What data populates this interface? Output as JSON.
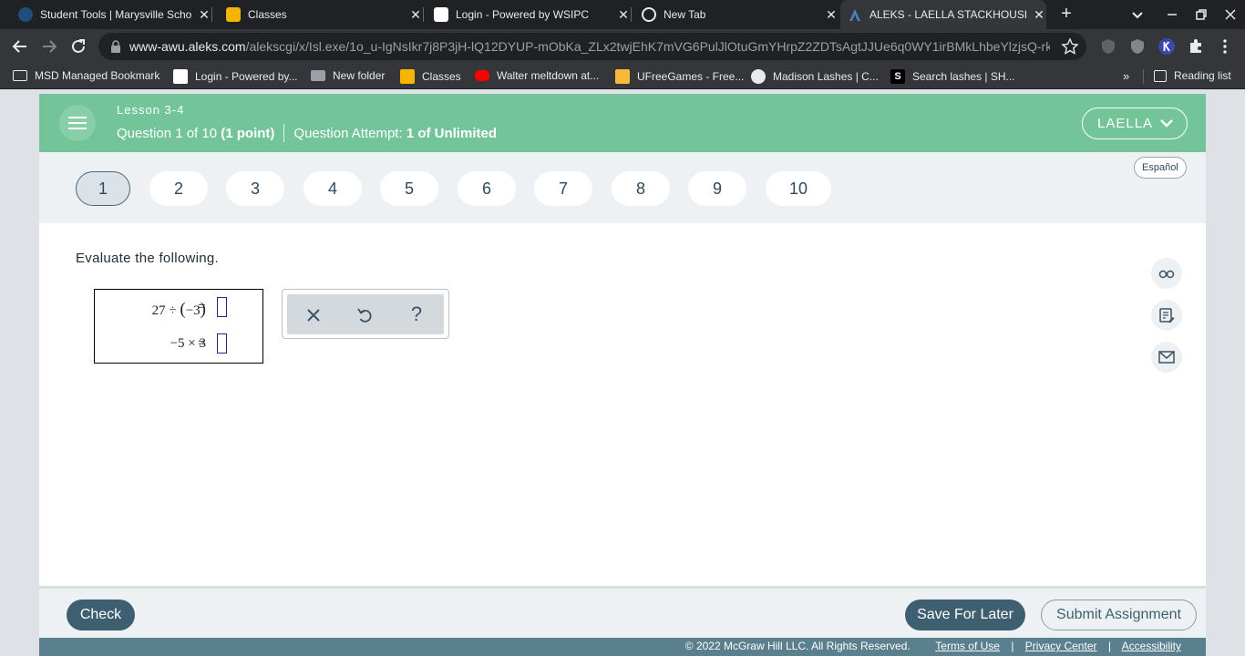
{
  "browser": {
    "tabs": [
      {
        "title": "Student Tools | Marysville Scho",
        "icon": "marysville-icon",
        "active": false
      },
      {
        "title": "Classes",
        "icon": "google-classroom-icon",
        "active": false
      },
      {
        "title": "Login - Powered by WSIPC",
        "icon": "wsipc-icon",
        "active": false
      },
      {
        "title": "New Tab",
        "icon": "chrome-icon",
        "active": false
      },
      {
        "title": "ALEKS - LAELLA STACKHOUSE",
        "icon": "aleks-icon",
        "active": true
      }
    ],
    "url_host": "www-awu.aleks.com",
    "url_path": "/alekscgi/x/Isl.exe/1o_u-IgNsIkr7j8P3jH-lQ12DYUP-mObKa_ZLx2twjEhK7mVG6PulJlOtuGmYHrpZ2ZDTsAgtJJUe6q0WY1irBMkLhbeYlzjsQ-rk...",
    "bookmarks": [
      {
        "label": "MSD Managed Bookmark",
        "icon": "folder-icon"
      },
      {
        "label": "Login - Powered by...",
        "icon": "wsipc-icon"
      },
      {
        "label": "New folder",
        "icon": "folder-icon"
      },
      {
        "label": "Classes",
        "icon": "google-classroom-icon"
      },
      {
        "label": "Walter meltdown at...",
        "icon": "youtube-icon"
      },
      {
        "label": "UFreeGames - Free...",
        "icon": "ufreegames-icon"
      },
      {
        "label": "Madison Lashes | C...",
        "icon": "globe-icon"
      },
      {
        "label": "Search lashes | SH...",
        "icon": "shein-icon"
      }
    ],
    "more_bookmarks": "»",
    "reading_list": "Reading list"
  },
  "header": {
    "lesson": "Lesson 3-4",
    "question_prefix": "Question 1 of 10",
    "question_points": "(1 point)",
    "attempt_label": "Question Attempt:",
    "attempt_value": "1 of Unlimited",
    "user": "LAELLA"
  },
  "question_nav": {
    "items": [
      "1",
      "2",
      "3",
      "4",
      "5",
      "6",
      "7",
      "8",
      "9",
      "10"
    ],
    "active_index": 0,
    "language_button": "Español"
  },
  "problem": {
    "prompt": "Evaluate the following.",
    "row1": {
      "a": "27",
      "op": "÷",
      "lparen": "(",
      "b": "−3",
      "rparen": ")",
      "eq": "="
    },
    "row2": {
      "a": "−5",
      "op": "×",
      "b": "3",
      "eq": "="
    }
  },
  "tools": [
    "close-icon",
    "undo-icon",
    "help-icon"
  ],
  "tool_help_glyph": "?",
  "footer": {
    "check": "Check",
    "save": "Save For Later",
    "submit": "Submit Assignment"
  },
  "copyright": {
    "text": "© 2022 McGraw Hill LLC. All Rights Reserved.",
    "terms": "Terms of Use",
    "privacy": "Privacy Center",
    "accessibility": "Accessibility",
    "separator": "|"
  },
  "colors": {
    "header_green": "#74c49a",
    "primary_button": "#3d5f70",
    "chrome_dark": "#202124",
    "chrome_toolbar": "#35363a"
  }
}
